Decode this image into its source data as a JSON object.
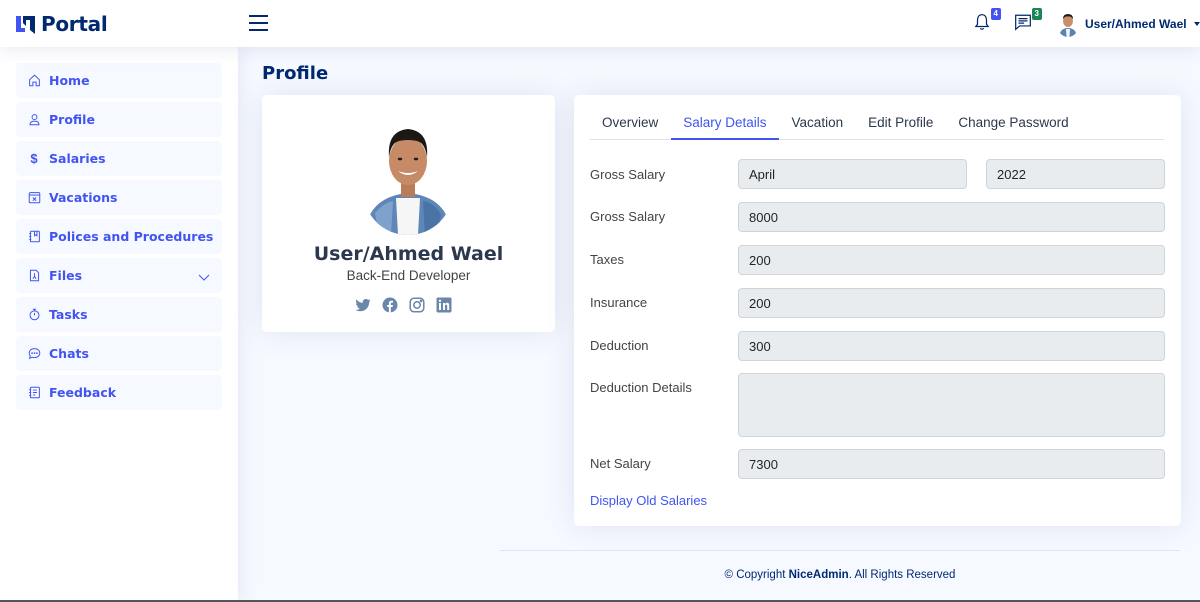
{
  "app": {
    "title": "Portal",
    "brand_color": "#4154f1",
    "dark_color": "#012970"
  },
  "header": {
    "notifications": {
      "icon": "bell-icon",
      "count": "4"
    },
    "messages": {
      "icon": "chat-left-text-icon",
      "count": "3"
    },
    "user_name": "User/Ahmed Wael"
  },
  "sidebar": {
    "items": [
      {
        "label": "Home",
        "icon": "house-icon"
      },
      {
        "label": "Profile",
        "icon": "person-icon"
      },
      {
        "label": "Salaries",
        "icon": "dollar-icon"
      },
      {
        "label": "Vacations",
        "icon": "calendar-x-icon"
      },
      {
        "label": "Polices and Procedures",
        "icon": "journal-bookmark-icon"
      },
      {
        "label": "Files",
        "icon": "file-pdf-icon",
        "has_submenu": true
      },
      {
        "label": "Tasks",
        "icon": "stopwatch-icon"
      },
      {
        "label": "Chats",
        "icon": "chat-dots-icon"
      },
      {
        "label": "Feedback",
        "icon": "journal-text-icon"
      }
    ]
  },
  "page": {
    "title": "Profile"
  },
  "profile": {
    "name": "User/Ahmed Wael",
    "role": "Back-End Developer",
    "socials": [
      "twitter",
      "facebook",
      "instagram",
      "linkedin"
    ]
  },
  "tabs": [
    {
      "label": "Overview",
      "active": false
    },
    {
      "label": "Salary Details",
      "active": true
    },
    {
      "label": "Vacation",
      "active": false
    },
    {
      "label": "Edit Profile",
      "active": false
    },
    {
      "label": "Change Password",
      "active": false
    }
  ],
  "salary": {
    "period_label": "Gross Salary",
    "month": "April",
    "year": "2022",
    "gross_label": "Gross Salary",
    "gross": "8000",
    "taxes_label": "Taxes",
    "taxes": "200",
    "insurance_label": "Insurance",
    "insurance": "200",
    "deduction_label": "Deduction",
    "deduction": "300",
    "deduction_details_label": "Deduction Details",
    "deduction_details": "",
    "net_label": "Net Salary",
    "net": "7300",
    "old_salaries_link": "Display Old Salaries"
  },
  "footer": {
    "prefix": "© Copyright ",
    "brand": "NiceAdmin",
    "suffix": ". All Rights Reserved"
  }
}
